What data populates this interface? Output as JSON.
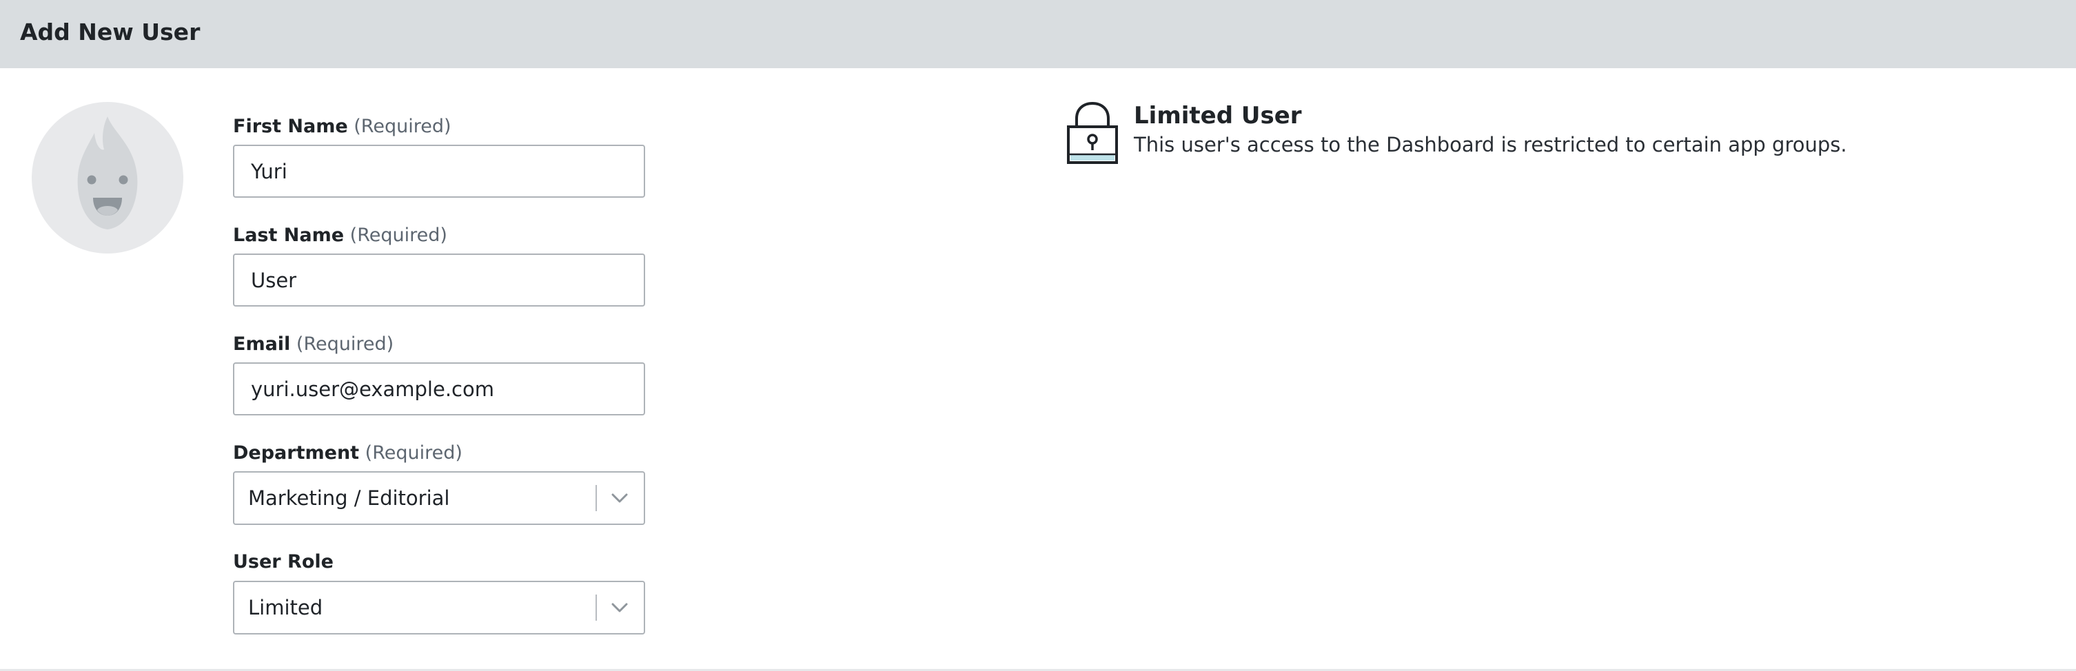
{
  "header": {
    "title": "Add New User"
  },
  "avatar": {
    "icon": "flame-mascot-icon"
  },
  "form": {
    "first_name": {
      "label": "First Name",
      "required_note": "(Required)",
      "value": "Yuri"
    },
    "last_name": {
      "label": "Last Name",
      "required_note": "(Required)",
      "value": "User"
    },
    "email": {
      "label": "Email",
      "required_note": "(Required)",
      "value": "yuri.user@example.com"
    },
    "department": {
      "label": "Department",
      "required_note": "(Required)",
      "value": "Marketing / Editorial"
    },
    "user_role": {
      "label": "User Role",
      "value": "Limited"
    }
  },
  "role_info": {
    "icon": "lock-icon",
    "title": "Limited User",
    "description": "This user's access to the Dashboard is restricted to certain app groups."
  },
  "colors": {
    "header_bg": "#d9dde0",
    "input_border": "#aeb3b8",
    "avatar_bg": "#e8e9eb",
    "lock_accent": "#bfe3ea"
  }
}
